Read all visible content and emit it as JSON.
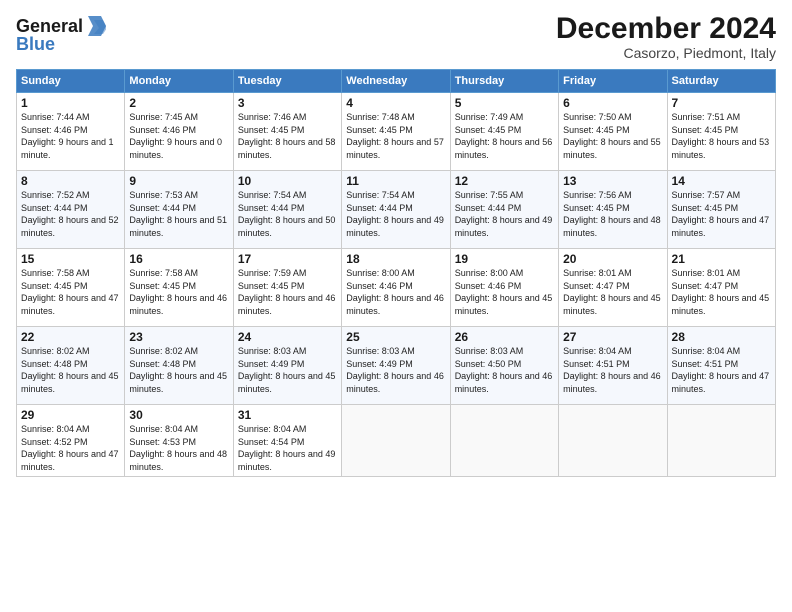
{
  "logo": {
    "line1": "General",
    "line2": "Blue"
  },
  "title": "December 2024",
  "subtitle": "Casorzo, Piedmont, Italy",
  "days_of_week": [
    "Sunday",
    "Monday",
    "Tuesday",
    "Wednesday",
    "Thursday",
    "Friday",
    "Saturday"
  ],
  "weeks": [
    [
      {
        "day": "1",
        "sunrise": "7:44 AM",
        "sunset": "4:46 PM",
        "daylight": "9 hours and 1 minute."
      },
      {
        "day": "2",
        "sunrise": "7:45 AM",
        "sunset": "4:46 PM",
        "daylight": "9 hours and 0 minutes."
      },
      {
        "day": "3",
        "sunrise": "7:46 AM",
        "sunset": "4:45 PM",
        "daylight": "8 hours and 58 minutes."
      },
      {
        "day": "4",
        "sunrise": "7:48 AM",
        "sunset": "4:45 PM",
        "daylight": "8 hours and 57 minutes."
      },
      {
        "day": "5",
        "sunrise": "7:49 AM",
        "sunset": "4:45 PM",
        "daylight": "8 hours and 56 minutes."
      },
      {
        "day": "6",
        "sunrise": "7:50 AM",
        "sunset": "4:45 PM",
        "daylight": "8 hours and 55 minutes."
      },
      {
        "day": "7",
        "sunrise": "7:51 AM",
        "sunset": "4:45 PM",
        "daylight": "8 hours and 53 minutes."
      }
    ],
    [
      {
        "day": "8",
        "sunrise": "7:52 AM",
        "sunset": "4:44 PM",
        "daylight": "8 hours and 52 minutes."
      },
      {
        "day": "9",
        "sunrise": "7:53 AM",
        "sunset": "4:44 PM",
        "daylight": "8 hours and 51 minutes."
      },
      {
        "day": "10",
        "sunrise": "7:54 AM",
        "sunset": "4:44 PM",
        "daylight": "8 hours and 50 minutes."
      },
      {
        "day": "11",
        "sunrise": "7:54 AM",
        "sunset": "4:44 PM",
        "daylight": "8 hours and 49 minutes."
      },
      {
        "day": "12",
        "sunrise": "7:55 AM",
        "sunset": "4:44 PM",
        "daylight": "8 hours and 49 minutes."
      },
      {
        "day": "13",
        "sunrise": "7:56 AM",
        "sunset": "4:45 PM",
        "daylight": "8 hours and 48 minutes."
      },
      {
        "day": "14",
        "sunrise": "7:57 AM",
        "sunset": "4:45 PM",
        "daylight": "8 hours and 47 minutes."
      }
    ],
    [
      {
        "day": "15",
        "sunrise": "7:58 AM",
        "sunset": "4:45 PM",
        "daylight": "8 hours and 47 minutes."
      },
      {
        "day": "16",
        "sunrise": "7:58 AM",
        "sunset": "4:45 PM",
        "daylight": "8 hours and 46 minutes."
      },
      {
        "day": "17",
        "sunrise": "7:59 AM",
        "sunset": "4:45 PM",
        "daylight": "8 hours and 46 minutes."
      },
      {
        "day": "18",
        "sunrise": "8:00 AM",
        "sunset": "4:46 PM",
        "daylight": "8 hours and 46 minutes."
      },
      {
        "day": "19",
        "sunrise": "8:00 AM",
        "sunset": "4:46 PM",
        "daylight": "8 hours and 45 minutes."
      },
      {
        "day": "20",
        "sunrise": "8:01 AM",
        "sunset": "4:47 PM",
        "daylight": "8 hours and 45 minutes."
      },
      {
        "day": "21",
        "sunrise": "8:01 AM",
        "sunset": "4:47 PM",
        "daylight": "8 hours and 45 minutes."
      }
    ],
    [
      {
        "day": "22",
        "sunrise": "8:02 AM",
        "sunset": "4:48 PM",
        "daylight": "8 hours and 45 minutes."
      },
      {
        "day": "23",
        "sunrise": "8:02 AM",
        "sunset": "4:48 PM",
        "daylight": "8 hours and 45 minutes."
      },
      {
        "day": "24",
        "sunrise": "8:03 AM",
        "sunset": "4:49 PM",
        "daylight": "8 hours and 45 minutes."
      },
      {
        "day": "25",
        "sunrise": "8:03 AM",
        "sunset": "4:49 PM",
        "daylight": "8 hours and 46 minutes."
      },
      {
        "day": "26",
        "sunrise": "8:03 AM",
        "sunset": "4:50 PM",
        "daylight": "8 hours and 46 minutes."
      },
      {
        "day": "27",
        "sunrise": "8:04 AM",
        "sunset": "4:51 PM",
        "daylight": "8 hours and 46 minutes."
      },
      {
        "day": "28",
        "sunrise": "8:04 AM",
        "sunset": "4:51 PM",
        "daylight": "8 hours and 47 minutes."
      }
    ],
    [
      {
        "day": "29",
        "sunrise": "8:04 AM",
        "sunset": "4:52 PM",
        "daylight": "8 hours and 47 minutes."
      },
      {
        "day": "30",
        "sunrise": "8:04 AM",
        "sunset": "4:53 PM",
        "daylight": "8 hours and 48 minutes."
      },
      {
        "day": "31",
        "sunrise": "8:04 AM",
        "sunset": "4:54 PM",
        "daylight": "8 hours and 49 minutes."
      },
      null,
      null,
      null,
      null
    ]
  ]
}
